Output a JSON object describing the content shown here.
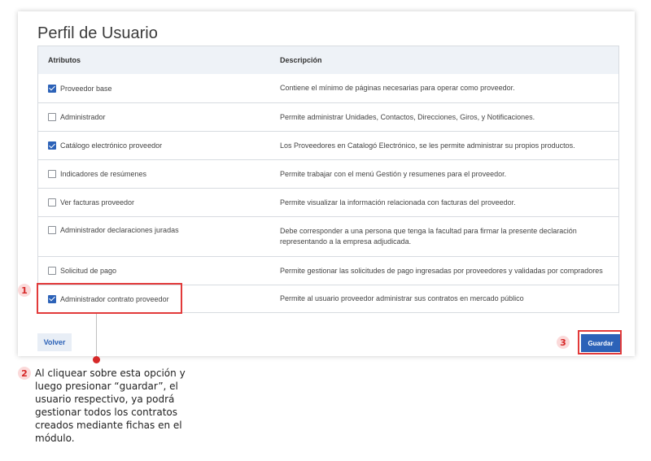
{
  "title": "Perfil de Usuario",
  "table": {
    "headers": [
      "Atributos",
      "Descripción"
    ],
    "rows": [
      {
        "label": "Proveedor base",
        "checked": true,
        "desc": "Contiene el mínimo de páginas necesarias para operar como proveedor."
      },
      {
        "label": "Administrador",
        "checked": false,
        "desc": "Permite administrar Unidades, Contactos, Direcciones, Giros, y Notificaciones."
      },
      {
        "label": "Catálogo electrónico proveedor",
        "checked": true,
        "desc": "Los Proveedores en Catalogó Electrónico, se les permite administrar su propios productos."
      },
      {
        "label": "Indicadores de resúmenes",
        "checked": false,
        "desc": "Permite trabajar con el menú Gestión y resumenes para el proveedor."
      },
      {
        "label": "Ver facturas proveedor",
        "checked": false,
        "desc": "Permite visualizar la información relacionada con facturas del proveedor."
      },
      {
        "label": "Administrador declaraciones juradas",
        "checked": false,
        "desc": "Debe corresponder a una persona que tenga la facultad para firmar la presente declaración representando a la empresa adjudicada."
      },
      {
        "label": "Solicitud de pago",
        "checked": false,
        "desc": "Permite gestionar las solicitudes de pago ingresadas por proveedores y validadas por compradores"
      },
      {
        "label": "Administrador contrato proveedor",
        "checked": true,
        "desc": "Permite al usuario proveedor administrar sus contratos en mercado público"
      }
    ]
  },
  "buttons": {
    "volver": "Volver",
    "guardar": "Guardar"
  },
  "annotations": {
    "badge1": "1",
    "badge2": "2",
    "badge3": "3",
    "note": "Al cliquear sobre esta opción y luego presionar “guardar”, el usuario respectivo, ya podrá gestionar todos los contratos creados mediante fichas en el módulo."
  },
  "colors": {
    "accent": "#2c62b8",
    "highlight": "#e23a3a"
  }
}
